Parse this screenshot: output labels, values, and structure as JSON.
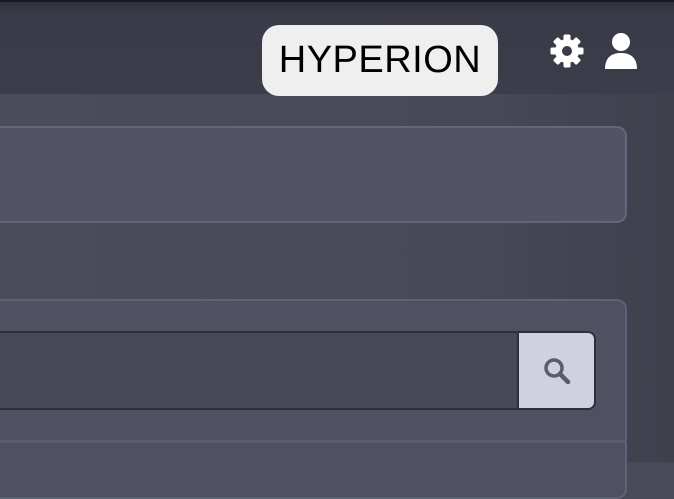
{
  "header": {
    "brand": "HYPERION",
    "icons": {
      "settings": "gear-icon",
      "user": "user-icon"
    }
  },
  "search": {
    "value": "",
    "placeholder": "",
    "button_icon": "search-icon"
  },
  "colors": {
    "background": "#484a5a",
    "header_bar": "#3c3d4b",
    "brand_badge": "#efefef",
    "panel": "#525466",
    "panel_border": "#646678",
    "search_button": "#cfd1e0"
  }
}
